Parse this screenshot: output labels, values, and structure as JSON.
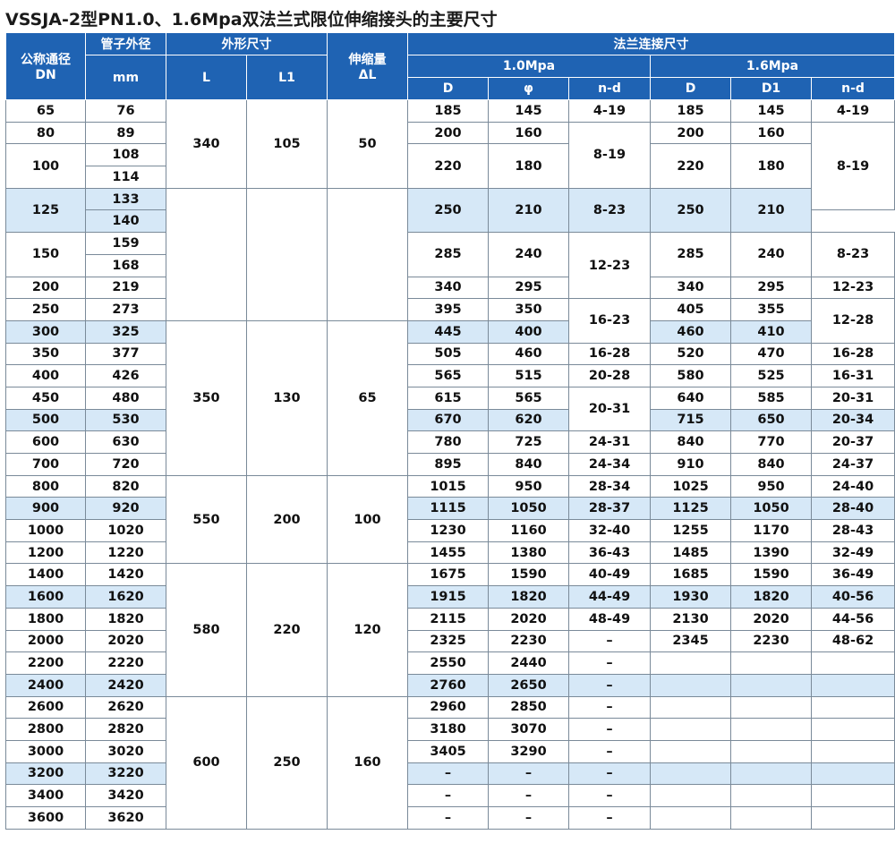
{
  "title": "VSSJA-2型PN1.0、1.6Mpa双法兰式限位伸缩接头的主要尺寸",
  "header": {
    "dn_top": "公称通径",
    "dn_bottom": "DN",
    "pipe_top": "管子外径",
    "pipe_bottom": "mm",
    "outer": "外形尺寸",
    "L": "L",
    "L1": "L1",
    "stroke_top": "伸缩量",
    "stroke_bottom": "ΔL",
    "flange": "法兰连接尺寸",
    "p10": "1.0Mpa",
    "p16": "1.6Mpa",
    "D": "D",
    "phi": "φ",
    "nd": "n-d",
    "D1": "D1"
  },
  "rows": [
    {
      "c0": {
        "v": "65",
        "h": 0
      },
      "c1": {
        "v": "76",
        "h": 0
      },
      "c2": {
        "v": "",
        "h": 0,
        "rs": 1
      },
      "c3": {
        "v": "",
        "h": 0,
        "rs": 1
      },
      "c4": {
        "v": "",
        "h": 0,
        "rs": 1
      },
      "c5": {
        "v": "185",
        "h": 0
      },
      "c6": {
        "v": "145",
        "h": 0
      },
      "c7": {
        "v": "4-19",
        "h": 0
      },
      "c8": {
        "v": "185",
        "h": 0
      },
      "c9": {
        "v": "145",
        "h": 0
      },
      "c10": {
        "v": "4-19",
        "h": 0
      }
    }
  ],
  "table": [
    [
      [
        "65",
        "",
        "",
        1
      ],
      [
        "76",
        "",
        "",
        1
      ],
      [
        "",
        "",
        "",
        1
      ],
      [
        "",
        "",
        "",
        1
      ],
      [
        "",
        "",
        "",
        1
      ],
      [
        "185",
        "",
        "",
        1
      ],
      [
        "145",
        "",
        "",
        1
      ],
      [
        "4-19",
        "",
        "",
        1
      ],
      [
        "185",
        "",
        "",
        1
      ],
      [
        "145",
        "",
        "",
        1
      ],
      [
        "4-19",
        "",
        "",
        1
      ]
    ]
  ],
  "cells": {
    "r0": [
      "65",
      "76",
      "",
      "",
      "",
      "185",
      "145",
      "4-19",
      "185",
      "145",
      "4-19"
    ],
    "r1": [
      "80",
      "89",
      "340",
      "105",
      "50",
      "200",
      "160",
      "8-19",
      "200",
      "160",
      "8-19"
    ],
    "r2": [
      "100",
      "108",
      "",
      "",
      "",
      "220",
      "180",
      "",
      "220",
      "180",
      ""
    ],
    "r3": [
      "",
      "114"
    ],
    "r4": [
      "125",
      "133",
      "",
      "",
      "",
      "250",
      "210",
      "8-23",
      "250",
      "210",
      ""
    ],
    "r5": [
      "",
      "140"
    ],
    "r6": [
      "150",
      "159",
      "340",
      "105",
      "50",
      "285",
      "240",
      "12-23",
      "285",
      "240",
      "8-23"
    ],
    "r7": [
      "",
      "168"
    ],
    "r8": [
      "200",
      "219",
      "",
      "",
      "",
      "340",
      "295",
      "",
      "340",
      "295",
      "12-23"
    ],
    "r9": [
      "250",
      "273",
      "",
      "",
      "",
      "395",
      "350",
      "16-23",
      "405",
      "355",
      "12-28"
    ],
    "r10": [
      "300",
      "325",
      "350",
      "130",
      "65",
      "445",
      "400",
      "",
      "460",
      "410",
      ""
    ],
    "r11": [
      "350",
      "377",
      "",
      "",
      "",
      "505",
      "460",
      "16-28",
      "520",
      "470",
      "16-28"
    ],
    "r12": [
      "400",
      "426",
      "",
      "",
      "",
      "565",
      "515",
      "20-28",
      "580",
      "525",
      "16-31"
    ],
    "r13": [
      "450",
      "480",
      "",
      "",
      "",
      "615",
      "565",
      "20-31",
      "640",
      "585",
      "20-31"
    ],
    "r14": [
      "500",
      "530",
      "",
      "",
      "",
      "670",
      "620",
      "",
      "715",
      "650",
      "20-34"
    ],
    "r15": [
      "600",
      "630",
      "",
      "",
      "",
      "780",
      "725",
      "24-31",
      "840",
      "770",
      "20-37"
    ],
    "r16": [
      "700",
      "720",
      "",
      "",
      "",
      "895",
      "840",
      "24-34",
      "910",
      "840",
      "24-37"
    ],
    "r17": [
      "800",
      "820",
      "550",
      "200",
      "100",
      "1015",
      "950",
      "28-34",
      "1025",
      "950",
      "24-40"
    ],
    "r18": [
      "900",
      "920",
      "",
      "",
      "",
      "1115",
      "1050",
      "28-37",
      "1125",
      "1050",
      "28-40"
    ],
    "r19": [
      "1000",
      "1020",
      "",
      "",
      "",
      "1230",
      "1160",
      "32-40",
      "1255",
      "1170",
      "28-43"
    ],
    "r20": [
      "1200",
      "1220",
      "",
      "",
      "",
      "1455",
      "1380",
      "36-43",
      "1485",
      "1390",
      "32-49"
    ],
    "r21": [
      "1400",
      "1420",
      "580",
      "220",
      "120",
      "1675",
      "1590",
      "40-49",
      "1685",
      "1590",
      "36-49"
    ],
    "r22": [
      "1600",
      "1620",
      "",
      "",
      "",
      "1915",
      "1820",
      "44-49",
      "1930",
      "1820",
      "40-56"
    ],
    "r23": [
      "1800",
      "1820",
      "",
      "",
      "",
      "2115",
      "2020",
      "48-49",
      "2130",
      "2020",
      "44-56"
    ],
    "r24": [
      "2000",
      "2020",
      "",
      "",
      "",
      "2325",
      "2230",
      "–",
      "2345",
      "2230",
      "48-62"
    ],
    "r25": [
      "2200",
      "2220",
      "",
      "",
      "",
      "2550",
      "2440",
      "–",
      "",
      "",
      ""
    ],
    "r26": [
      "2400",
      "2420",
      "",
      "",
      "",
      "2760",
      "2650",
      "–",
      "",
      "",
      ""
    ],
    "r27": [
      "2600",
      "2620",
      "600",
      "250",
      "160",
      "2960",
      "2850",
      "–",
      "",
      "",
      ""
    ],
    "r28": [
      "2800",
      "2820",
      "",
      "",
      "",
      "3180",
      "3070",
      "–",
      "",
      "",
      ""
    ],
    "r29": [
      "3000",
      "3020",
      "",
      "",
      "",
      "3405",
      "3290",
      "–",
      "",
      "",
      ""
    ],
    "r30": [
      "3200",
      "3220",
      "",
      "",
      "",
      "–",
      "–",
      "–",
      "",
      "",
      ""
    ],
    "r31": [
      "3400",
      "3420",
      "",
      "",
      "",
      "–",
      "–",
      "–",
      "",
      "",
      ""
    ],
    "r32": [
      "3600",
      "3620",
      "",
      "",
      "",
      "–",
      "–",
      "–",
      "",
      "",
      ""
    ]
  }
}
